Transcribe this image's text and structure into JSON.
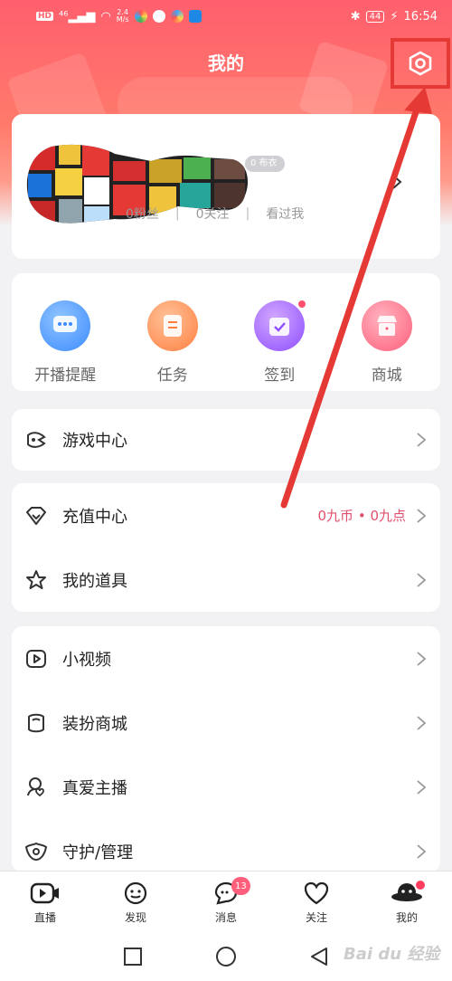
{
  "status_bar": {
    "network_badge": "HD",
    "signal_label": "⁴⁶",
    "speed": "2.4\nM/s",
    "bluetooth": "✱",
    "battery": "44",
    "charging": "⚡",
    "time": "16:54"
  },
  "header": {
    "title": "我的",
    "settings_icon": "hexagon-gear-icon"
  },
  "profile": {
    "level_badge": "0 布衣",
    "fans": "0粉丝",
    "following": "0关注",
    "viewed_me": "看过我",
    "separator": "|"
  },
  "quick_actions": [
    {
      "label": "开播提醒",
      "icon": "chat-bubble-icon",
      "color": "#4a90ff",
      "dot": false
    },
    {
      "label": "任务",
      "icon": "task-list-icon",
      "color": "#ff8a4a",
      "dot": false
    },
    {
      "label": "签到",
      "icon": "calendar-check-icon",
      "color": "#9b59ff",
      "dot": true
    },
    {
      "label": "商城",
      "icon": "shop-icon",
      "color": "#ff5f7a",
      "dot": false
    }
  ],
  "game_section": {
    "label": "游戏中心",
    "icon": "gamepad-icon"
  },
  "recharge_section": {
    "items": [
      {
        "label": "充值中心",
        "icon": "diamond-icon",
        "right": "0九币 • 0九点"
      },
      {
        "label": "我的道具",
        "icon": "star-icon",
        "right": ""
      }
    ]
  },
  "more_section": {
    "items": [
      {
        "label": "小视频",
        "icon": "video-icon"
      },
      {
        "label": "装扮商城",
        "icon": "dress-up-icon"
      },
      {
        "label": "真爱主播",
        "icon": "heart-person-icon"
      },
      {
        "label": "守护/管理",
        "icon": "shield-icon"
      }
    ]
  },
  "tabs": [
    {
      "label": "直播",
      "icon": "live-camera-icon"
    },
    {
      "label": "发现",
      "icon": "discover-face-icon"
    },
    {
      "label": "消息",
      "icon": "message-bubble-icon",
      "badge": "13"
    },
    {
      "label": "关注",
      "icon": "heart-icon"
    },
    {
      "label": "我的",
      "icon": "profile-avatar-icon",
      "dot": true
    }
  ],
  "nav": {
    "back": "back-triangle-icon",
    "home": "home-circle-icon",
    "recents": "recents-square-icon"
  },
  "watermark": "Bai du 经验",
  "colors": {
    "accent": "#ff5f6d",
    "highlight": "#e53935",
    "price": "#e0506c"
  }
}
